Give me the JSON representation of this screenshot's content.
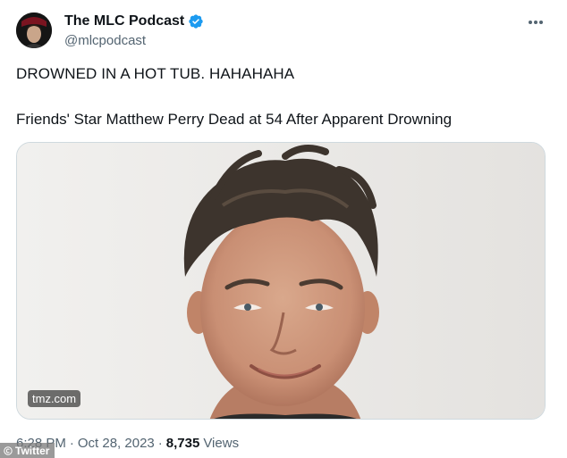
{
  "author": {
    "display_name": "The MLC Podcast",
    "handle": "@mlcpodcast",
    "verified": true,
    "verified_color": "#1d9bf0"
  },
  "tweet": {
    "text_line1": "DROWNED IN A HOT TUB. HAHAHAHA",
    "text_line2": "Friends' Star Matthew Perry Dead at 54 After Apparent Drowning"
  },
  "media": {
    "domain": "tmz.com"
  },
  "meta": {
    "time": "6:28 PM",
    "date": "Oct 28, 2023",
    "views_count": "8,735",
    "views_label": "Views",
    "separator": "·"
  },
  "watermark": {
    "label": "Twitter"
  },
  "icons": {
    "more": "more-horizontal-icon",
    "verified": "verified-badge-icon"
  }
}
